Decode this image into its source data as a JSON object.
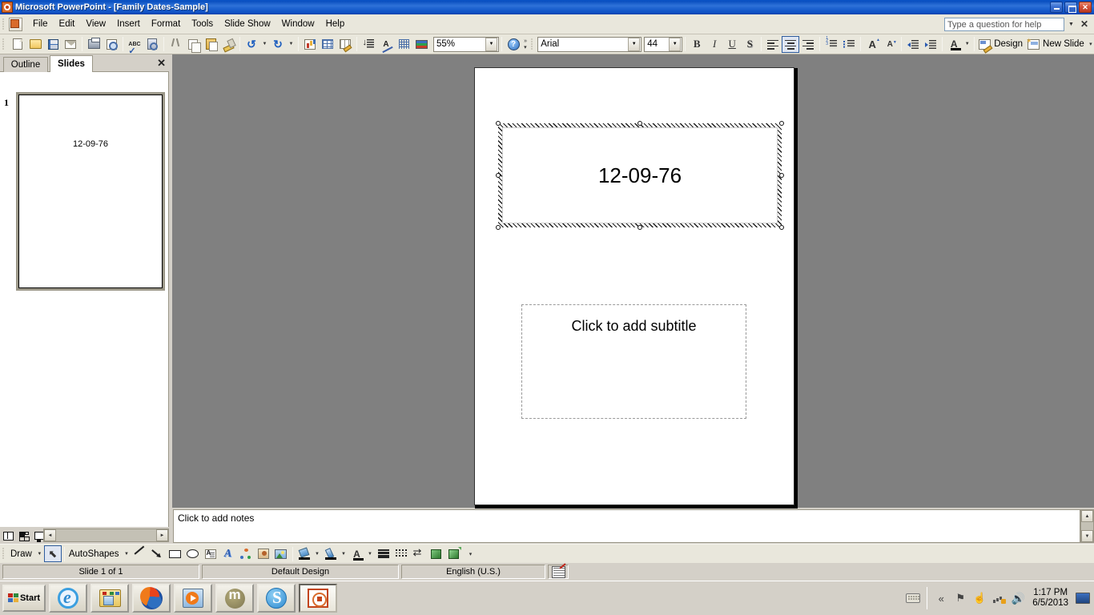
{
  "window": {
    "title": "Microsoft PowerPoint - [Family Dates-Sample]",
    "app_icon": "powerpoint-icon",
    "minimize_label": "Minimize",
    "restore_label": "Restore",
    "close_label": "Close"
  },
  "menubar": {
    "items": [
      {
        "label": "File",
        "mnemonic": "F"
      },
      {
        "label": "Edit",
        "mnemonic": "E"
      },
      {
        "label": "View",
        "mnemonic": "V"
      },
      {
        "label": "Insert",
        "mnemonic": "I"
      },
      {
        "label": "Format",
        "mnemonic": "o"
      },
      {
        "label": "Tools",
        "mnemonic": "T"
      },
      {
        "label": "Slide Show",
        "mnemonic": "S"
      },
      {
        "label": "Window",
        "mnemonic": "W"
      },
      {
        "label": "Help",
        "mnemonic": "H"
      }
    ],
    "ask_placeholder": "Type a question for help",
    "ask_value": "",
    "close_label": "✕"
  },
  "toolbar": {
    "buttons": [
      {
        "name": "new-button",
        "icon": "new-document-icon",
        "label": "New"
      },
      {
        "name": "open-button",
        "icon": "open-folder-icon",
        "label": "Open"
      },
      {
        "name": "save-button",
        "icon": "save-disk-icon",
        "label": "Save"
      },
      {
        "name": "mail-button",
        "icon": "email-icon",
        "label": "E-mail"
      },
      {
        "name": "print-button",
        "icon": "printer-icon",
        "label": "Print"
      },
      {
        "name": "print-preview-button",
        "icon": "print-preview-icon",
        "label": "Print Preview"
      },
      {
        "name": "spelling-button",
        "icon": "spelling-abc-icon",
        "label": "Spelling"
      },
      {
        "name": "research-button",
        "icon": "research-icon",
        "label": "Research"
      },
      {
        "name": "cut-button",
        "icon": "scissors-icon",
        "label": "Cut"
      },
      {
        "name": "copy-button",
        "icon": "copy-icon",
        "label": "Copy"
      },
      {
        "name": "paste-button",
        "icon": "clipboard-icon",
        "label": "Paste"
      },
      {
        "name": "format-painter-button",
        "icon": "paintbrush-icon",
        "label": "Format Painter"
      },
      {
        "name": "undo-button",
        "icon": "undo-arrow-icon",
        "label": "Undo"
      },
      {
        "name": "redo-button",
        "icon": "redo-arrow-icon",
        "label": "Redo"
      },
      {
        "name": "insert-chart-button",
        "icon": "bar-chart-icon",
        "label": "Insert Chart"
      },
      {
        "name": "insert-table-button",
        "icon": "table-icon",
        "label": "Insert Table"
      },
      {
        "name": "tables-borders-button",
        "icon": "table-pencil-icon",
        "label": "Tables and Borders"
      },
      {
        "name": "expand-all-button",
        "icon": "sort-descending-icon",
        "label": "Expand All"
      },
      {
        "name": "show-formatting-button",
        "icon": "show-formatting-icon",
        "label": "Show Formatting"
      },
      {
        "name": "show-grid-button",
        "icon": "grid-icon",
        "label": "Show Grid"
      },
      {
        "name": "color-grayscale-button",
        "icon": "color-bars-icon",
        "label": "Color/Grayscale"
      }
    ],
    "zoom_value": "55%",
    "help_label": "Microsoft PowerPoint Help"
  },
  "formatbar": {
    "font_name": "Arial",
    "font_size": "44",
    "bold_label": "B",
    "italic_label": "I",
    "underline_label": "U",
    "shadow_label": "S",
    "align_left_label": "Align Left",
    "align_center_label": "Center",
    "align_right_label": "Align Right",
    "numbering_label": "Numbering",
    "bullets_label": "Bullets",
    "increase_font_label": "A",
    "decrease_font_label": "A",
    "decrease_indent_label": "Decrease Indent",
    "increase_indent_label": "Increase Indent",
    "font_color_label": "A",
    "design_label": "Design",
    "new_slide_label": "New Slide"
  },
  "left_pane": {
    "tabs": [
      {
        "label": "Outline",
        "active": false
      },
      {
        "label": "Slides",
        "active": true
      }
    ],
    "close_label": "✕",
    "slides": [
      {
        "number": "1",
        "title": "12-09-76"
      }
    ]
  },
  "slide": {
    "title_placeholder": {
      "text": "12-09-76",
      "selected": true
    },
    "subtitle_placeholder": {
      "text": "Click to add subtitle",
      "selected": false
    }
  },
  "notes": {
    "text": "Click to add notes"
  },
  "view_buttons": [
    {
      "name": "normal-view-button",
      "label": "Normal View"
    },
    {
      "name": "slide-sorter-view-button",
      "label": "Slide Sorter View"
    },
    {
      "name": "slide-show-button",
      "label": "Slide Show"
    }
  ],
  "drawbar": {
    "draw_label": "Draw",
    "autoshapes_label": "AutoShapes",
    "buttons": [
      {
        "name": "select-objects-button",
        "icon": "arrow-pointer-icon",
        "label": "Select Objects"
      },
      {
        "name": "line-button",
        "icon": "line-icon",
        "label": "Line"
      },
      {
        "name": "arrow-button",
        "icon": "arrow-icon",
        "label": "Arrow"
      },
      {
        "name": "rectangle-button",
        "icon": "rectangle-icon",
        "label": "Rectangle"
      },
      {
        "name": "oval-button",
        "icon": "oval-icon",
        "label": "Oval"
      },
      {
        "name": "text-box-button",
        "icon": "text-box-icon",
        "label": "Text Box"
      },
      {
        "name": "wordart-button",
        "icon": "wordart-icon",
        "label": "Insert WordArt"
      },
      {
        "name": "diagram-button",
        "icon": "diagram-icon",
        "label": "Insert Diagram"
      },
      {
        "name": "clip-art-button",
        "icon": "clip-art-icon",
        "label": "Insert Clip Art"
      },
      {
        "name": "picture-button",
        "icon": "picture-icon",
        "label": "Insert Picture"
      },
      {
        "name": "fill-color-button",
        "icon": "paint-bucket-icon",
        "label": "Fill Color"
      },
      {
        "name": "line-color-button",
        "icon": "pen-icon",
        "label": "Line Color"
      },
      {
        "name": "font-color-button",
        "icon": "font-color-icon",
        "label": "Font Color"
      },
      {
        "name": "line-style-button",
        "icon": "line-style-icon",
        "label": "Line Style"
      },
      {
        "name": "dash-style-button",
        "icon": "dash-style-icon",
        "label": "Dash Style"
      },
      {
        "name": "arrow-style-button",
        "icon": "arrow-style-icon",
        "label": "Arrow Style"
      },
      {
        "name": "shadow-style-button",
        "icon": "shadow-style-icon",
        "label": "Shadow Style"
      },
      {
        "name": "3d-style-button",
        "icon": "three-d-style-icon",
        "label": "3-D Style"
      }
    ]
  },
  "statusbar": {
    "slide_counter": "Slide 1 of 1",
    "design_name": "Default Design",
    "language": "English (U.S.)",
    "spellcheck_label": "Spelling status"
  },
  "taskbar": {
    "start_label": "Start",
    "apps": [
      {
        "name": "taskbar-internet-explorer",
        "icon": "internet-explorer-icon",
        "active": false
      },
      {
        "name": "taskbar-windows-explorer",
        "icon": "folder-explorer-icon",
        "active": false
      },
      {
        "name": "taskbar-firefox",
        "icon": "firefox-icon",
        "active": false
      },
      {
        "name": "taskbar-media-player",
        "icon": "media-player-icon",
        "active": false
      },
      {
        "name": "taskbar-moodle",
        "icon": "moodle-icon",
        "active": false
      },
      {
        "name": "taskbar-skype",
        "icon": "skype-icon",
        "active": false
      },
      {
        "name": "taskbar-powerpoint",
        "icon": "powerpoint-icon",
        "active": true
      }
    ],
    "tray": {
      "icons": [
        "keyboard-icon",
        "show-hidden-icons-chevron",
        "flag-icon",
        "safely-remove-icon",
        "network-icon",
        "volume-icon"
      ],
      "time": "1:17 PM",
      "date": "6/5/2013",
      "show_desktop_label": "Show Desktop"
    }
  },
  "colors": {
    "title_gradient_start": "#0a55c8",
    "title_gradient_end": "#0b3fa8",
    "chrome": "#e9e7dc",
    "classic_face": "#d4d0c8",
    "slide_backdrop": "#808080",
    "accent_blue": "#2f5d9e"
  }
}
